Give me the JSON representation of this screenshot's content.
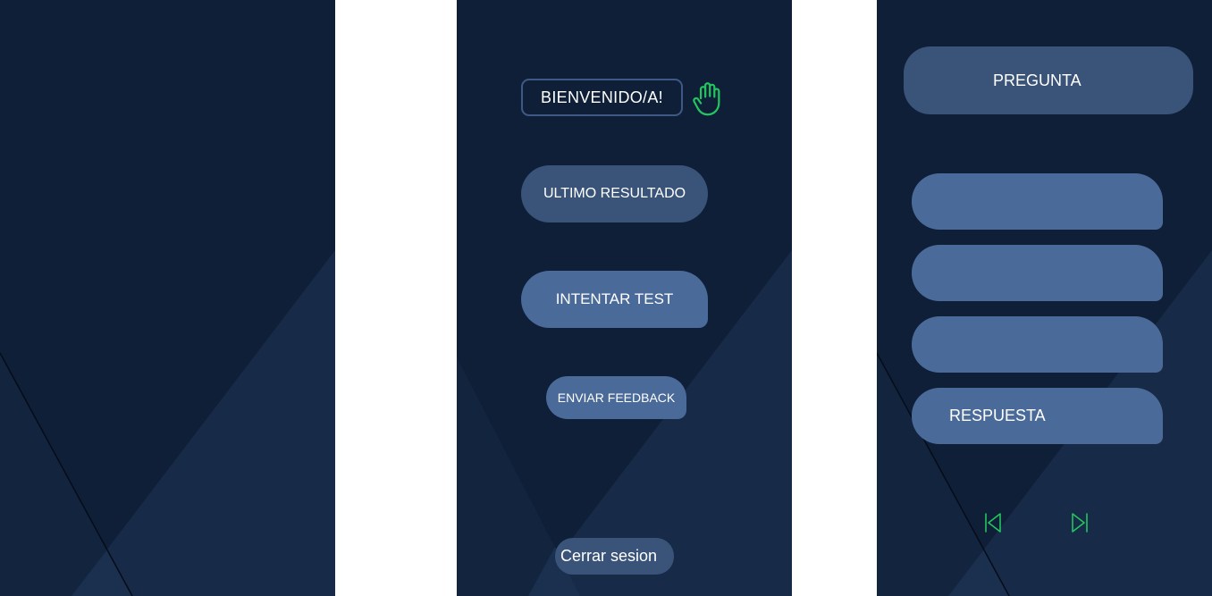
{
  "colors": {
    "panel_bg": "#0f1f38",
    "panel_shape": "#172a47",
    "button_dark": "#3a5479",
    "button_light": "#4a6a99",
    "accent_green": "#22c55e"
  },
  "home": {
    "welcome_label": "BIENVENIDO/A!",
    "welcome_icon": "waving-hand-icon",
    "last_result_label": "ULTIMO RESULTADO",
    "try_test_label": "INTENTAR TEST",
    "feedback_label": "ENVIAR FEEDBACK",
    "logout_label": "Cerrar sesion"
  },
  "quiz": {
    "question_label": "PREGUNTA",
    "answers": [
      "",
      "",
      "",
      "RESPUESTA"
    ],
    "prev_icon": "skip-back-icon",
    "next_icon": "skip-forward-icon"
  }
}
